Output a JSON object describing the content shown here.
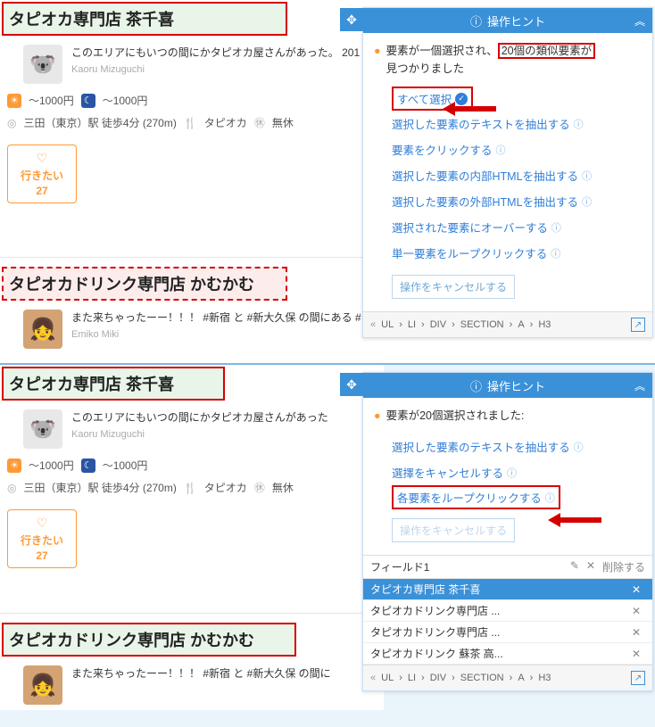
{
  "top": {
    "listing1": {
      "title": "タピオカ専門店 茶千喜",
      "review": "このエリアにもいつの間にかタピオカ屋さんがあった。 201",
      "reviewer": "Kaoru Mizuguchi",
      "price_day": "～1000円",
      "price_night": "～1000円",
      "location": "三田（東京）駅 徒歩4分 (270m)",
      "genre": "タピオカ",
      "holiday": "無休",
      "want_label": "行きたい",
      "want_count": "27"
    },
    "listing2": {
      "title": "タピオカドリンク専門店 かむかむ",
      "review": "また来ちゃったーー！！！ #新宿 と #新大久保 の間にある #",
      "reviewer": "Emiko Miki"
    },
    "hint": {
      "title": "操作ヒント",
      "msg_a": "要素が一個選択され、",
      "msg_b": "20個の類似要素が",
      "msg_c": "見つかりました",
      "act_select_all": "すべて選択",
      "act_extract_text": "選択した要素のテキストを抽出する",
      "act_click": "要素をクリックする",
      "act_inner_html": "選択した要素の内部HTMLを抽出する",
      "act_outer_html": "選択した要素の外部HTMLを抽出する",
      "act_hover": "選択された要素にオーバーする",
      "act_loop_single": "単一要素をループクリックする",
      "act_cancel": "操作をキャンセルする",
      "crumbs": [
        "UL",
        "LI",
        "DIV",
        "SECTION",
        "A",
        "H3"
      ]
    }
  },
  "bottom": {
    "listing1": {
      "title": "タピオカ専門店 茶千喜",
      "review": "このエリアにもいつの間にかタピオカ屋さんがあった",
      "reviewer": "Kaoru Mizuguchi",
      "price_day": "～1000円",
      "price_night": "～1000円",
      "location": "三田（東京）駅 徒歩4分 (270m)",
      "genre": "タピオカ",
      "holiday": "無休",
      "want_label": "行きたい",
      "want_count": "27"
    },
    "listing2": {
      "title": "タピオカドリンク専門店 かむかむ",
      "review": "また来ちゃったーー！！！ #新宿 と #新大久保 の間に"
    },
    "hint": {
      "title": "操作ヒント",
      "msg": "要素が20個選択されました:",
      "act_extract_text": "選択した要素のテキストを抽出する",
      "act_cancel_sel": "選擇をキャンセルする",
      "act_loop_each": "各要素をループクリックする",
      "act_cancel": "操作をキャンセルする",
      "field_name": "フィールド1",
      "field_delete": "削除する",
      "rows": [
        "タピオカ専門店 茶千喜",
        "タピオカドリンク専門店 ...",
        "タピオカドリンク専門店 ...",
        "タピオカドリンク 蘇茶 高..."
      ],
      "crumbs": [
        "UL",
        "LI",
        "DIV",
        "SECTION",
        "A",
        "H3"
      ]
    }
  }
}
